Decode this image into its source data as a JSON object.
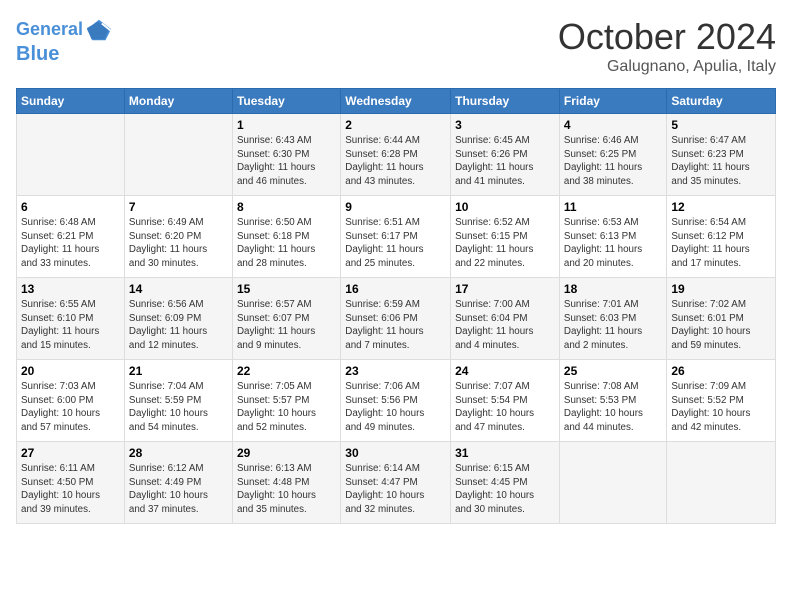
{
  "header": {
    "logo_line1": "General",
    "logo_line2": "Blue",
    "month": "October 2024",
    "location": "Galugnano, Apulia, Italy"
  },
  "weekdays": [
    "Sunday",
    "Monday",
    "Tuesday",
    "Wednesday",
    "Thursday",
    "Friday",
    "Saturday"
  ],
  "weeks": [
    [
      {
        "day": "",
        "content": ""
      },
      {
        "day": "",
        "content": ""
      },
      {
        "day": "1",
        "content": "Sunrise: 6:43 AM\nSunset: 6:30 PM\nDaylight: 11 hours\nand 46 minutes."
      },
      {
        "day": "2",
        "content": "Sunrise: 6:44 AM\nSunset: 6:28 PM\nDaylight: 11 hours\nand 43 minutes."
      },
      {
        "day": "3",
        "content": "Sunrise: 6:45 AM\nSunset: 6:26 PM\nDaylight: 11 hours\nand 41 minutes."
      },
      {
        "day": "4",
        "content": "Sunrise: 6:46 AM\nSunset: 6:25 PM\nDaylight: 11 hours\nand 38 minutes."
      },
      {
        "day": "5",
        "content": "Sunrise: 6:47 AM\nSunset: 6:23 PM\nDaylight: 11 hours\nand 35 minutes."
      }
    ],
    [
      {
        "day": "6",
        "content": "Sunrise: 6:48 AM\nSunset: 6:21 PM\nDaylight: 11 hours\nand 33 minutes."
      },
      {
        "day": "7",
        "content": "Sunrise: 6:49 AM\nSunset: 6:20 PM\nDaylight: 11 hours\nand 30 minutes."
      },
      {
        "day": "8",
        "content": "Sunrise: 6:50 AM\nSunset: 6:18 PM\nDaylight: 11 hours\nand 28 minutes."
      },
      {
        "day": "9",
        "content": "Sunrise: 6:51 AM\nSunset: 6:17 PM\nDaylight: 11 hours\nand 25 minutes."
      },
      {
        "day": "10",
        "content": "Sunrise: 6:52 AM\nSunset: 6:15 PM\nDaylight: 11 hours\nand 22 minutes."
      },
      {
        "day": "11",
        "content": "Sunrise: 6:53 AM\nSunset: 6:13 PM\nDaylight: 11 hours\nand 20 minutes."
      },
      {
        "day": "12",
        "content": "Sunrise: 6:54 AM\nSunset: 6:12 PM\nDaylight: 11 hours\nand 17 minutes."
      }
    ],
    [
      {
        "day": "13",
        "content": "Sunrise: 6:55 AM\nSunset: 6:10 PM\nDaylight: 11 hours\nand 15 minutes."
      },
      {
        "day": "14",
        "content": "Sunrise: 6:56 AM\nSunset: 6:09 PM\nDaylight: 11 hours\nand 12 minutes."
      },
      {
        "day": "15",
        "content": "Sunrise: 6:57 AM\nSunset: 6:07 PM\nDaylight: 11 hours\nand 9 minutes."
      },
      {
        "day": "16",
        "content": "Sunrise: 6:59 AM\nSunset: 6:06 PM\nDaylight: 11 hours\nand 7 minutes."
      },
      {
        "day": "17",
        "content": "Sunrise: 7:00 AM\nSunset: 6:04 PM\nDaylight: 11 hours\nand 4 minutes."
      },
      {
        "day": "18",
        "content": "Sunrise: 7:01 AM\nSunset: 6:03 PM\nDaylight: 11 hours\nand 2 minutes."
      },
      {
        "day": "19",
        "content": "Sunrise: 7:02 AM\nSunset: 6:01 PM\nDaylight: 10 hours\nand 59 minutes."
      }
    ],
    [
      {
        "day": "20",
        "content": "Sunrise: 7:03 AM\nSunset: 6:00 PM\nDaylight: 10 hours\nand 57 minutes."
      },
      {
        "day": "21",
        "content": "Sunrise: 7:04 AM\nSunset: 5:59 PM\nDaylight: 10 hours\nand 54 minutes."
      },
      {
        "day": "22",
        "content": "Sunrise: 7:05 AM\nSunset: 5:57 PM\nDaylight: 10 hours\nand 52 minutes."
      },
      {
        "day": "23",
        "content": "Sunrise: 7:06 AM\nSunset: 5:56 PM\nDaylight: 10 hours\nand 49 minutes."
      },
      {
        "day": "24",
        "content": "Sunrise: 7:07 AM\nSunset: 5:54 PM\nDaylight: 10 hours\nand 47 minutes."
      },
      {
        "day": "25",
        "content": "Sunrise: 7:08 AM\nSunset: 5:53 PM\nDaylight: 10 hours\nand 44 minutes."
      },
      {
        "day": "26",
        "content": "Sunrise: 7:09 AM\nSunset: 5:52 PM\nDaylight: 10 hours\nand 42 minutes."
      }
    ],
    [
      {
        "day": "27",
        "content": "Sunrise: 6:11 AM\nSunset: 4:50 PM\nDaylight: 10 hours\nand 39 minutes."
      },
      {
        "day": "28",
        "content": "Sunrise: 6:12 AM\nSunset: 4:49 PM\nDaylight: 10 hours\nand 37 minutes."
      },
      {
        "day": "29",
        "content": "Sunrise: 6:13 AM\nSunset: 4:48 PM\nDaylight: 10 hours\nand 35 minutes."
      },
      {
        "day": "30",
        "content": "Sunrise: 6:14 AM\nSunset: 4:47 PM\nDaylight: 10 hours\nand 32 minutes."
      },
      {
        "day": "31",
        "content": "Sunrise: 6:15 AM\nSunset: 4:45 PM\nDaylight: 10 hours\nand 30 minutes."
      },
      {
        "day": "",
        "content": ""
      },
      {
        "day": "",
        "content": ""
      }
    ]
  ]
}
